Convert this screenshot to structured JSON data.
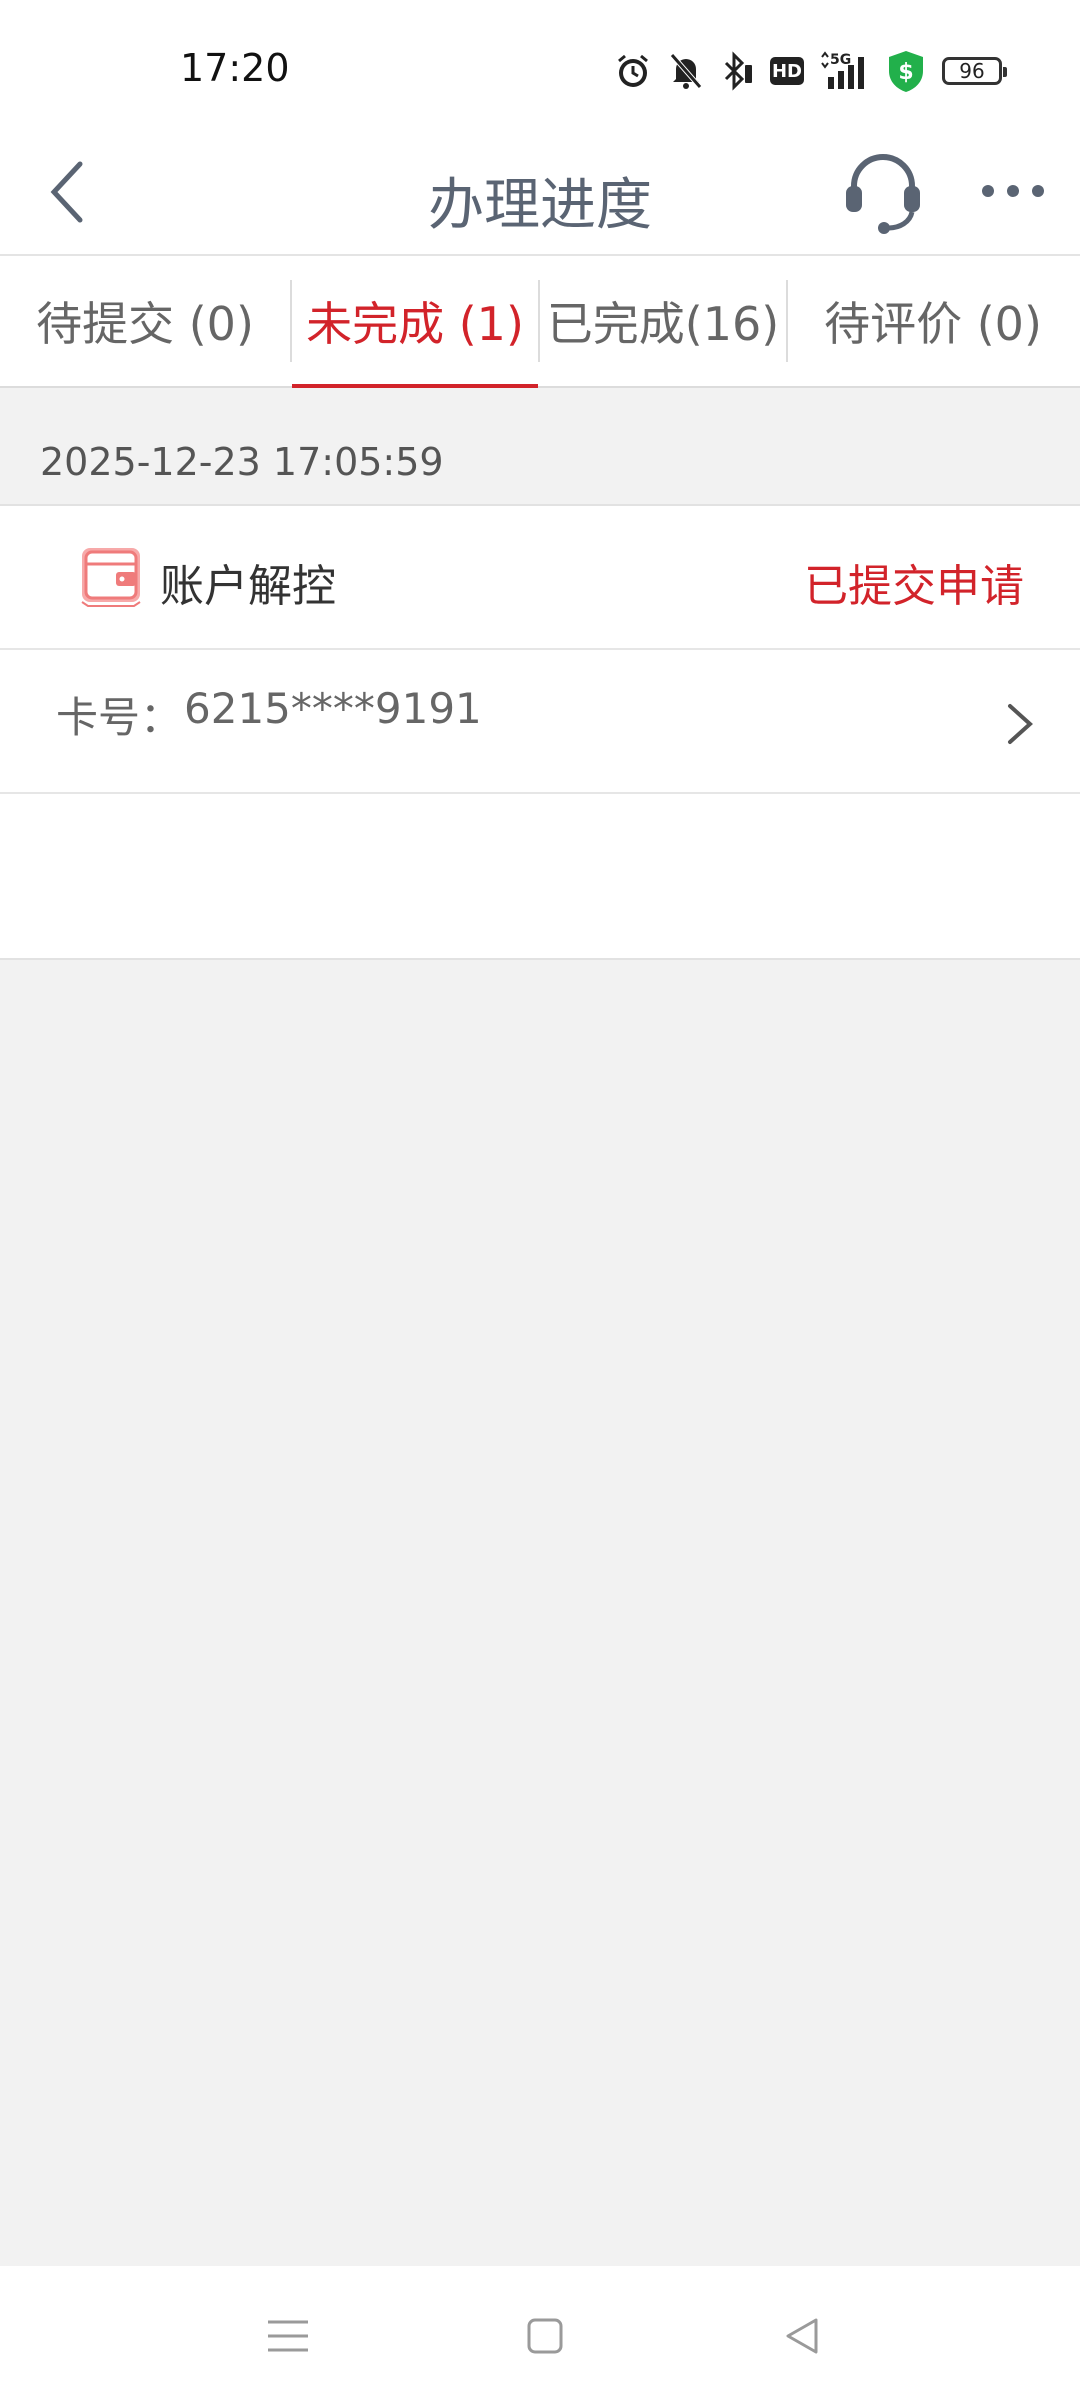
{
  "status_bar": {
    "time": "17:20",
    "icons": [
      "alarm-icon",
      "mute-icon",
      "bluetooth-icon",
      "hd-icon",
      "5g-signal-icon",
      "security-shield-icon",
      "battery-icon"
    ],
    "hd_label": "HD",
    "network_label": "5G",
    "battery_level": "96"
  },
  "header": {
    "title": "办理进度",
    "back_icon": "chevron-left-icon",
    "support_icon": "headset-icon",
    "more_icon": "more-dots-icon"
  },
  "tabs": [
    {
      "label": "待提交 (0)",
      "active": false
    },
    {
      "label": "未完成 (1)",
      "active": true
    },
    {
      "label": "已完成(16)",
      "active": false
    },
    {
      "label": "待评价 (0)",
      "active": false
    }
  ],
  "record": {
    "datetime": "2025-12-23 17:05:59",
    "business_name": "账户解控",
    "business_icon": "wallet-card-icon",
    "status": "已提交申请",
    "card_label": "卡号：",
    "card_number": "6215****9191"
  },
  "colors": {
    "accent": "#d2232a",
    "title_text": "#5a6473",
    "background": "#f2f2f2"
  },
  "bottom_nav": {
    "icons": [
      "menu-icon",
      "home-icon",
      "back-icon"
    ]
  }
}
